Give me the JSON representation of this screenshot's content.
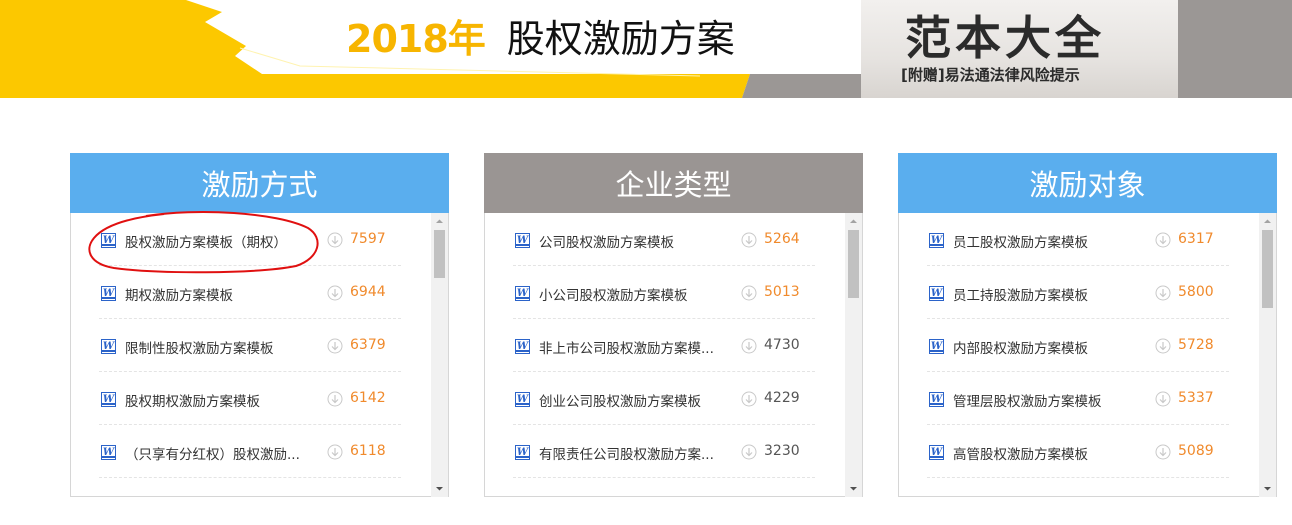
{
  "banner": {
    "year": "2018年",
    "title": "股权激励方案",
    "promo_title": "范本大全",
    "promo_subtitle": "[附赠]易法通法律风险提示",
    "colors": {
      "yellow": "#fcc800",
      "gray": "#9b9795",
      "year": "#f7b500"
    }
  },
  "panels": [
    {
      "title": "激励方式",
      "header_color": "#5aaeee",
      "items": [
        {
          "title": "股权激励方案模板（期权）",
          "count": "7597"
        },
        {
          "title": "期权激励方案模板",
          "count": "6944"
        },
        {
          "title": "限制性股权激励方案模板",
          "count": "6379"
        },
        {
          "title": "股权期权激励方案模板",
          "count": "6142"
        },
        {
          "title": "（只享有分红权）股权激励...",
          "count": "6118"
        }
      ]
    },
    {
      "title": "企业类型",
      "header_color": "#9a9593",
      "items": [
        {
          "title": "公司股权激励方案模板",
          "count": "5264"
        },
        {
          "title": "小公司股权激励方案模板",
          "count": "5013"
        },
        {
          "title": "非上市公司股权激励方案模...",
          "count": "4730"
        },
        {
          "title": "创业公司股权激励方案模板",
          "count": "4229"
        },
        {
          "title": "有限责任公司股权激励方案...",
          "count": "3230"
        }
      ]
    },
    {
      "title": "激励对象",
      "header_color": "#5aaeee",
      "items": [
        {
          "title": "员工股权激励方案模板",
          "count": "6317"
        },
        {
          "title": "员工持股激励方案模板",
          "count": "5800"
        },
        {
          "title": "内部股权激励方案模板",
          "count": "5728"
        },
        {
          "title": "管理层股权激励方案模板",
          "count": "5337"
        },
        {
          "title": "高管股权激励方案模板",
          "count": "5089"
        }
      ]
    }
  ],
  "icons": {
    "doc": "word-doc-icon",
    "download": "download-circle-icon"
  },
  "count_color": "#f08a2c",
  "annotation_color": "#e01010"
}
